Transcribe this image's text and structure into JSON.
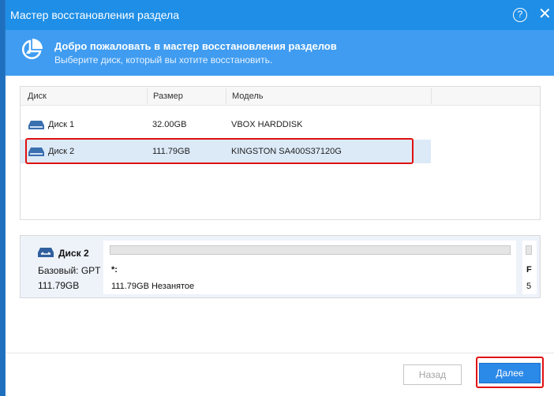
{
  "window": {
    "title": "Мастер восстановления раздела",
    "help_label": "?",
    "close_label": "✕"
  },
  "banner": {
    "heading": "Добро пожаловать в мастер восстановления разделов",
    "subtitle": "Выберите диск, который вы хотите восстановить."
  },
  "table": {
    "columns": [
      "Диск",
      "Размер",
      "Модель"
    ],
    "rows": [
      {
        "disk": "Диск 1",
        "size": "32.00GB",
        "model": "VBOX HARDDISK",
        "selected": false
      },
      {
        "disk": "Диск 2",
        "size": "111.79GB",
        "model": "KINGSTON SA400S37120G",
        "selected": true
      }
    ]
  },
  "details": {
    "disk_name": "Диск 2",
    "disk_type": "Базовый: GPT",
    "disk_size": "111.79GB",
    "partition_label": "*:",
    "partition_info": "111.79GB Незанятое",
    "partition2_label": "F",
    "partition2_info": "5"
  },
  "buttons": {
    "back": "Назад",
    "next": "Далее"
  },
  "colors": {
    "titlebar": "#1e8ee6",
    "banner": "#3f9cf0",
    "selected_row": "#dceaf8",
    "highlight": "#e01010",
    "primary_button": "#2b89e8"
  }
}
